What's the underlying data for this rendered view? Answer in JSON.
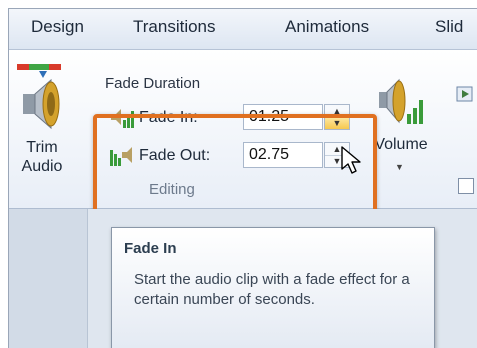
{
  "tabs": [
    "Design",
    "Transitions",
    "Animations",
    "Slid"
  ],
  "trim_audio": {
    "label": "Trim\nAudio"
  },
  "fade_group": {
    "title": "Fade Duration",
    "fade_in_label": "Fade In:",
    "fade_in_value": "01.25",
    "fade_out_label": "Fade Out:",
    "fade_out_value": "02.75",
    "group_label": "Editing"
  },
  "volume": {
    "label": "Volume"
  },
  "tooltip": {
    "title": "Fade In",
    "body": "Start the audio clip with a fade effect for a certain number of seconds."
  },
  "colors": {
    "highlight": "#e07020",
    "accent": "#f6c84f"
  }
}
